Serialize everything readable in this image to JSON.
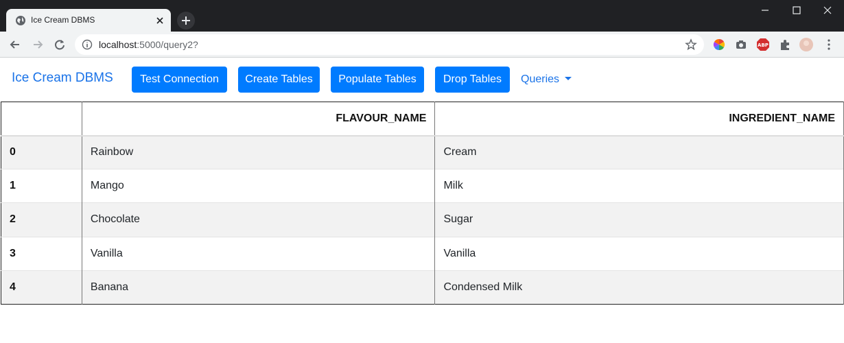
{
  "browser": {
    "tab_title": "Ice Cream DBMS",
    "url_host": "localhost",
    "url_path": ":5000/query2?"
  },
  "navbar": {
    "brand": "Ice Cream DBMS",
    "buttons": [
      "Test Connection",
      "Create Tables",
      "Populate Tables",
      "Drop Tables"
    ],
    "queries_label": "Queries",
    "accent_color": "#007bff"
  },
  "table": {
    "columns": [
      "",
      "FLAVOUR_NAME",
      "INGREDIENT_NAME"
    ],
    "rows": [
      {
        "index": "0",
        "flavour": "Rainbow",
        "ingredient": "Cream"
      },
      {
        "index": "1",
        "flavour": "Mango",
        "ingredient": "Milk"
      },
      {
        "index": "2",
        "flavour": "Chocolate",
        "ingredient": "Sugar"
      },
      {
        "index": "3",
        "flavour": "Vanilla",
        "ingredient": "Vanilla"
      },
      {
        "index": "4",
        "flavour": "Banana",
        "ingredient": "Condensed Milk"
      }
    ]
  }
}
